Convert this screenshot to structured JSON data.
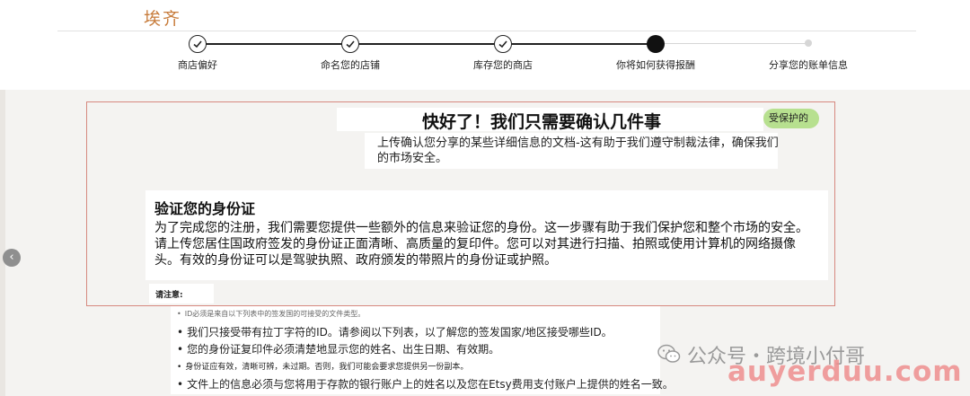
{
  "brand": {
    "logo_text": "埃齐",
    "accent": "#c77b3a"
  },
  "stepper": {
    "steps": [
      {
        "label": "商店偏好",
        "state": "done"
      },
      {
        "label": "命名您的店铺",
        "state": "done"
      },
      {
        "label": "库存您的商店",
        "state": "done"
      },
      {
        "label": "你将如何获得报酬",
        "state": "current"
      },
      {
        "label": "分享您的账单信息",
        "state": "todo"
      }
    ]
  },
  "verify": {
    "headline": "快好了！我们只需要确认几件事",
    "badge": "受保护的",
    "subtext": "上传确认您分享的某些详细信息的文档-这有助于我们遵守制裁法律，确保我们的市场安全。"
  },
  "id_section": {
    "title": "验证您的身份证",
    "description": "为了完成您的注册，我们需要您提供一些额外的信息来验证您的身份。这一步骤有助于我们保护您和整个市场的安全。请上传您居住国政府签发的身份证正面清晰、高质量的复印件。您可以对其进行扫描、拍照或使用计算机的网络摄像头。有效的身份证可以是驾驶执照、政府颁发的带照片的身份证或护照。",
    "note_label": "请注意:",
    "bullets": [
      "ID必须是来自以下列表中的签发国的可接受的文件类型。",
      "我们只接受带有拉丁字符的ID。请参阅以下列表，以了解您的签发国家/地区接受哪些ID。",
      "您的身份证复印件必须清楚地显示您的姓名、出生日期、有效期。",
      "身份证应有效，清晰可辨，未过期。否则，我们可能会要求您提供另一份副本。",
      "文件上的信息必须与您将用于存款的银行账户上的姓名以及您在Etsy费用支付账户上提供的姓名一致。"
    ]
  },
  "carousel": {
    "prev_glyph": "‹"
  },
  "watermark": {
    "channel": "公众号・跨境小付哥",
    "domain": "auyerduu.com"
  },
  "colors": {
    "frame": "#d6887f",
    "badge": "#b7e08f",
    "stage": "#f4f3f1"
  }
}
